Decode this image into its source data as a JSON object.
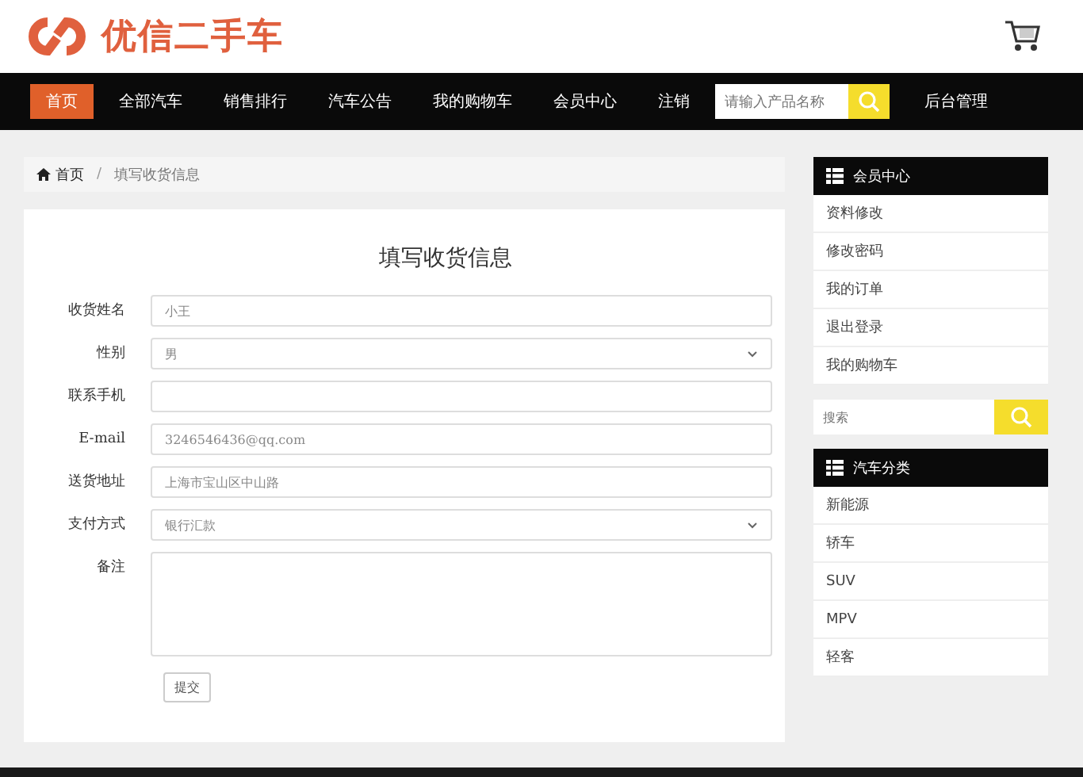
{
  "header": {
    "logo_text": "优信二手车"
  },
  "nav": {
    "items": [
      {
        "label": "首页",
        "selected": true
      },
      {
        "label": "全部汽车",
        "selected": false
      },
      {
        "label": "销售排行",
        "selected": false
      },
      {
        "label": "汽车公告",
        "selected": false
      },
      {
        "label": "我的购物车",
        "selected": false
      },
      {
        "label": "会员中心",
        "selected": false
      },
      {
        "label": "注销",
        "selected": false
      }
    ],
    "search": {
      "placeholder": "请输入产品名称"
    },
    "admin_link": "后台管理"
  },
  "breadcrumb": {
    "home": "首页",
    "separator": "/",
    "current": "填写收货信息"
  },
  "form": {
    "title": "填写收货信息",
    "fields": [
      {
        "label": "收货姓名",
        "kind": "input",
        "value": "小王"
      },
      {
        "label": "性别",
        "kind": "select",
        "value": "男"
      },
      {
        "label": "联系手机",
        "kind": "input"
      },
      {
        "label": "E-mail",
        "kind": "input",
        "value": "3246546436@qq.com"
      },
      {
        "label": "送货地址",
        "kind": "input",
        "value": "上海市宝山区中山路"
      },
      {
        "label": "支付方式",
        "kind": "select",
        "value": "银行汇款"
      },
      {
        "label": "备注",
        "kind": "textarea"
      }
    ],
    "submit": "提交"
  },
  "sidebar": {
    "panels": [
      {
        "title": "会员中心",
        "items": [
          "资料修改",
          "修改密码",
          "我的订单",
          "退出登录",
          "我的购物车"
        ]
      },
      {
        "kind": "search",
        "placeholder": "搜索"
      },
      {
        "title": "汽车分类",
        "items": [
          "新能源",
          "轿车",
          "SUV",
          "MPV",
          "轻客"
        ]
      }
    ]
  }
}
